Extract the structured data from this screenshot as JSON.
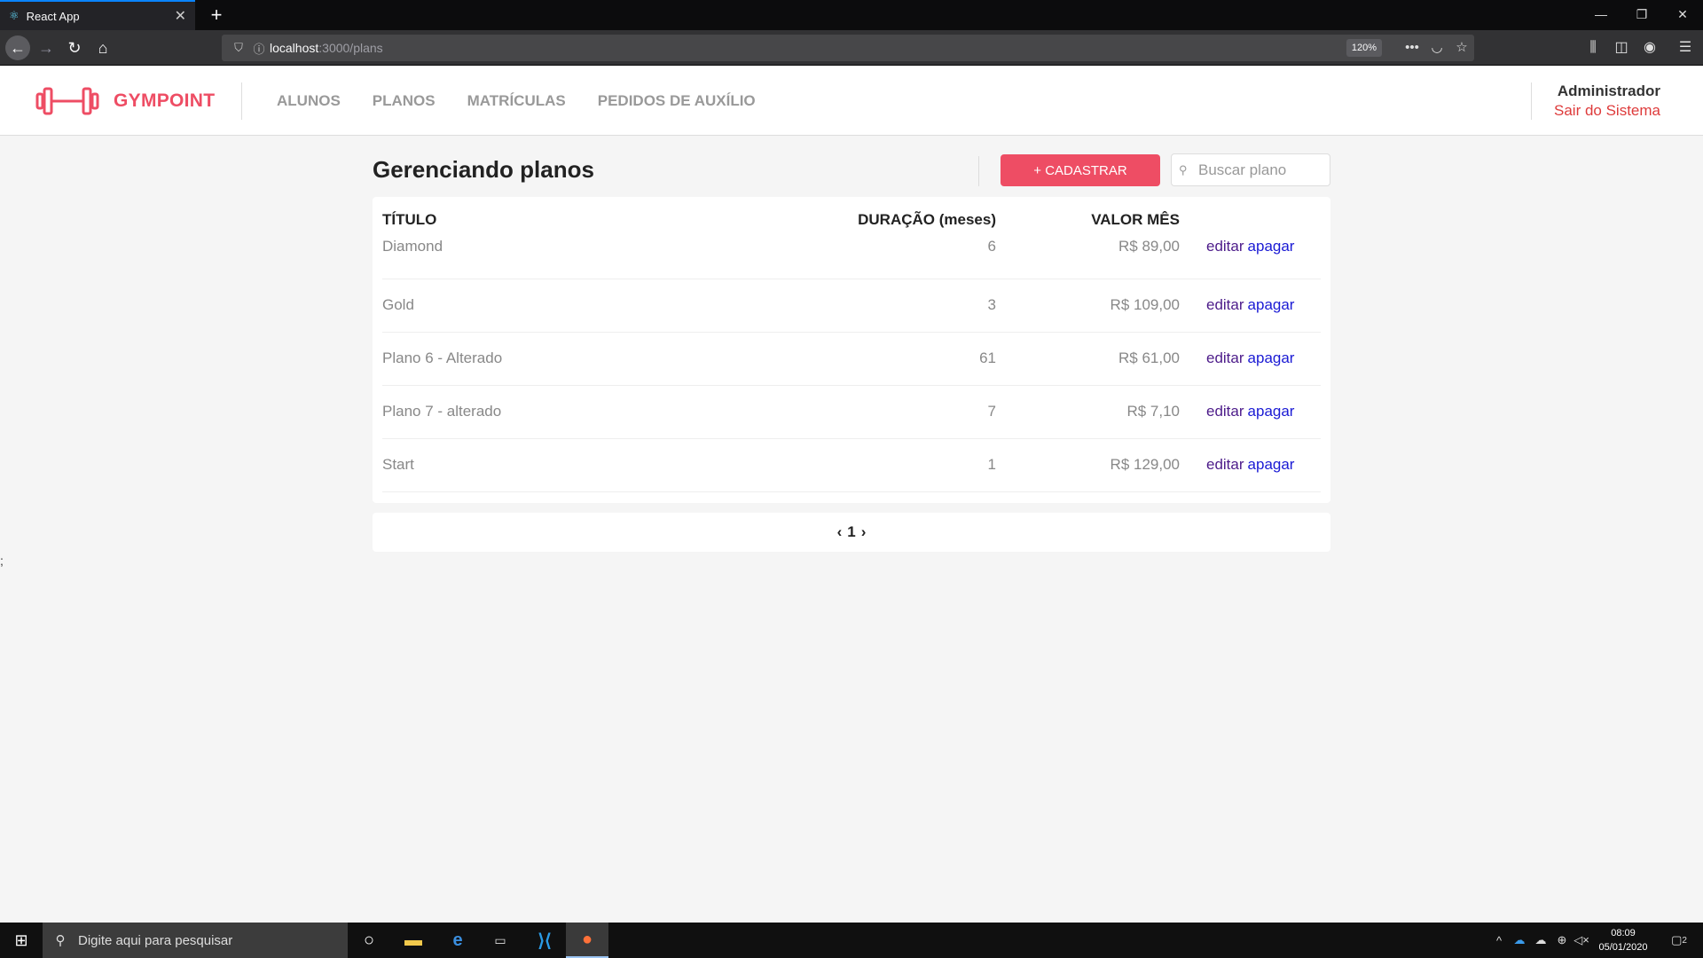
{
  "browser": {
    "tab_title": "React App",
    "tab_close": "✕",
    "new_tab": "+",
    "url_host": "localhost",
    "url_path": ":3000/plans",
    "zoom": "120%",
    "icons": [
      "react-favicon",
      "back-icon",
      "forward-icon",
      "reload-icon",
      "home-icon",
      "shield-icon",
      "info-icon",
      "more-icon",
      "pocket-icon",
      "star-icon",
      "library-icon",
      "sidebar-icon",
      "account-icon",
      "menu-icon"
    ]
  },
  "header": {
    "logo_text": "GYMPOINT",
    "nav": [
      "ALUNOS",
      "PLANOS",
      "MATRÍCULAS",
      "PEDIDOS DE AUXÍLIO"
    ],
    "user_name": "Administrador",
    "logout": "Sair do Sistema"
  },
  "page": {
    "title": "Gerenciando planos",
    "add_button": "+ CADASTRAR",
    "search_placeholder": "Buscar plano"
  },
  "table": {
    "columns": [
      "TÍTULO",
      "DURAÇÃO (meses)",
      "VALOR MÊS"
    ],
    "edit_label": "editar",
    "delete_label": "apagar",
    "rows": [
      {
        "title": "Diamond",
        "duration": "6",
        "price": "R$ 89,00"
      },
      {
        "title": "Gold",
        "duration": "3",
        "price": "R$ 109,00"
      },
      {
        "title": "Plano 6 - Alterado",
        "duration": "61",
        "price": "R$ 61,00"
      },
      {
        "title": "Plano 7 - alterado",
        "duration": "7",
        "price": "R$ 7,10"
      },
      {
        "title": "Start",
        "duration": "1",
        "price": "R$ 129,00"
      }
    ]
  },
  "pagination": {
    "prev": "‹",
    "page": "1",
    "next": "›"
  },
  "stray_text": ";",
  "taskbar": {
    "search_placeholder": "Digite aqui para pesquisar",
    "time": "08:09",
    "date": "05/01/2020",
    "notifications": "2"
  },
  "colors": {
    "accent": "#ee4d64",
    "edit_link": "#4d1c8a",
    "delete_link": "#1a1ad4",
    "logout": "#de3b3b"
  }
}
